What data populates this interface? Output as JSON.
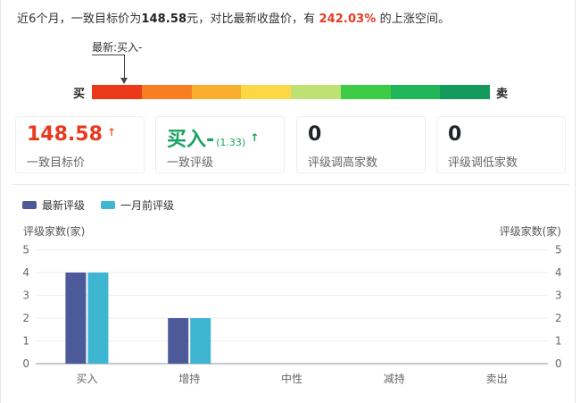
{
  "summary": {
    "prefix": "近6个月，一致目标价为",
    "target_price": "148.58",
    "mid": "元，对比最新收盘价，有",
    "upside": "242.03%",
    "suffix": "的上涨空间。"
  },
  "rating_scale": {
    "marker_label": "最新:买入-",
    "left_label": "买",
    "right_label": "卖",
    "colors": [
      "#ea3a1a",
      "#f77e22",
      "#faae2e",
      "#fdd746",
      "#bde173",
      "#3ecc48",
      "#22b559",
      "#139a5c"
    ]
  },
  "cards": [
    {
      "value": "148.58",
      "sub": "",
      "arrow": "↑",
      "label": "一致目标价"
    },
    {
      "value": "买入-",
      "sub": "(1.33)",
      "arrow": "↑",
      "label": "一致评级"
    },
    {
      "value": "0",
      "sub": "",
      "arrow": "",
      "label": "评级调高家数"
    },
    {
      "value": "0",
      "sub": "",
      "arrow": "",
      "label": "评级调低家数"
    }
  ],
  "chart_data": {
    "type": "bar",
    "categories": [
      "买入",
      "增持",
      "中性",
      "减持",
      "卖出"
    ],
    "series": [
      {
        "name": "最新评级",
        "color": "#4d5a9a",
        "values": [
          4,
          2,
          0,
          0,
          0
        ]
      },
      {
        "name": "一月前评级",
        "color": "#3fb6d1",
        "values": [
          4,
          2,
          0,
          0,
          0
        ]
      }
    ],
    "ylabel_left": "评级家数(家)",
    "ylabel_right": "评级家数(家)",
    "ylim": [
      0,
      5
    ],
    "yticks": [
      0,
      1,
      2,
      3,
      4,
      5
    ],
    "grid": true,
    "legend_position": "top-left"
  }
}
